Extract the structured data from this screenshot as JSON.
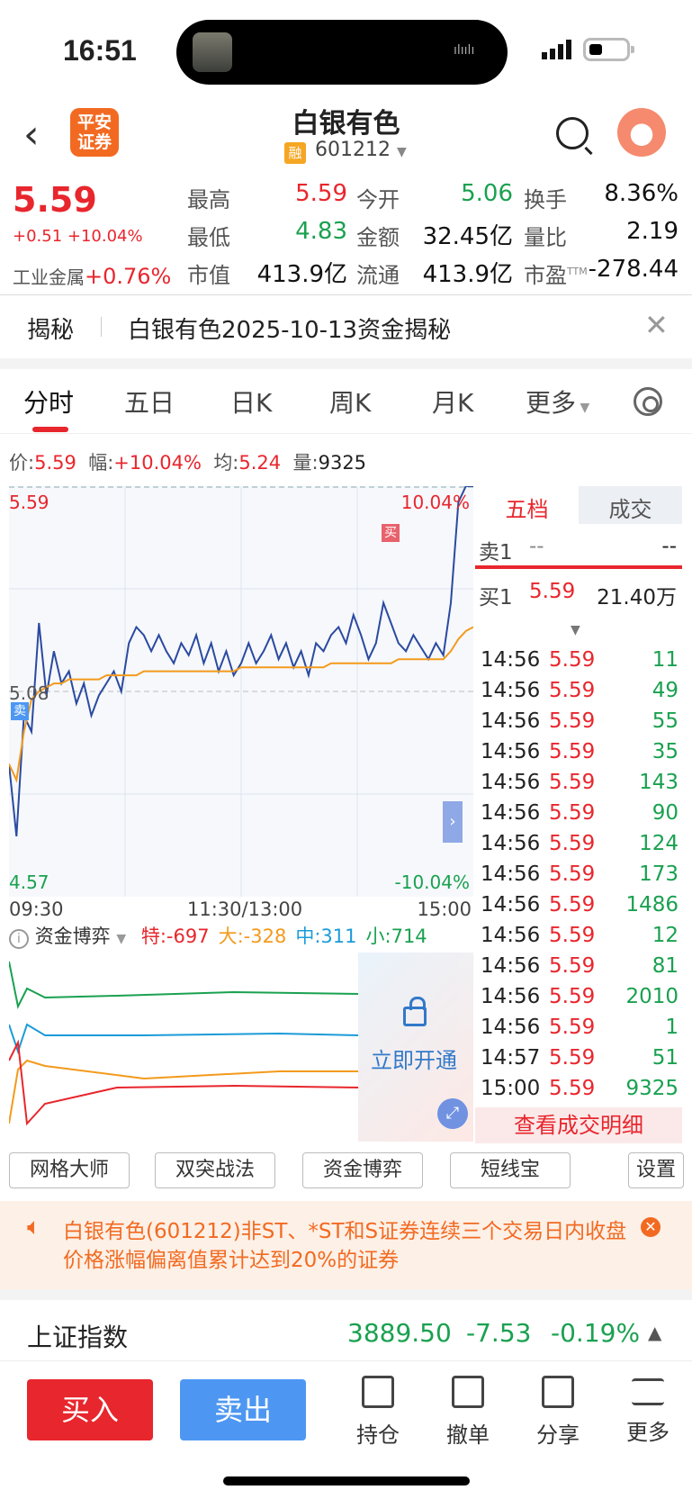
{
  "status_bar": {
    "time": "16:51"
  },
  "header": {
    "logo_text": "平安证券",
    "logo_line1": "平安",
    "logo_line2": "证券",
    "stock_name": "白银有色",
    "margin_tag": "融",
    "stock_code": "601212"
  },
  "quote": {
    "price": "5.59",
    "change": "+0.51 +10.04%",
    "sector_name": "工业金属",
    "sector_change": "+0.76%",
    "fields": [
      {
        "label": "最高",
        "value": "5.59",
        "color": "red"
      },
      {
        "label": "今开",
        "value": "5.06",
        "color": "green"
      },
      {
        "label": "换手",
        "value": "8.36%",
        "color": "black"
      },
      {
        "label": "最低",
        "value": "4.83",
        "color": "green"
      },
      {
        "label": "金额",
        "value": "32.45亿",
        "color": "black"
      },
      {
        "label": "量比",
        "value": "2.19",
        "color": "black"
      },
      {
        "label": "市值",
        "value": "413.9亿",
        "color": "black"
      },
      {
        "label": "流通",
        "value": "413.9亿",
        "color": "black"
      },
      {
        "label": "市盈",
        "value": "-278.44",
        "color": "black",
        "sup": "TTM"
      }
    ]
  },
  "reveal_banner": {
    "tag": "揭秘",
    "text": "白银有色2025-10-13资金揭秘"
  },
  "tabs": [
    "分时",
    "五日",
    "日K",
    "周K",
    "月K",
    "更多"
  ],
  "info_line": {
    "price_label": "价:",
    "price": "5.59",
    "amp_label": "幅:",
    "amp": "+10.04%",
    "avg_label": "均:",
    "avg": "5.24",
    "vol_label": "量:",
    "vol": "9325"
  },
  "chart_data": {
    "type": "line",
    "ylim": [
      4.57,
      5.59
    ],
    "y_ticks": [
      "5.59",
      "5.08",
      "4.57"
    ],
    "pct_ticks": [
      "10.04%",
      "-10.04%"
    ],
    "x_ticks": [
      "09:30",
      "11:30/13:00",
      "15:00"
    ],
    "markers": [
      "卖",
      "买"
    ],
    "series": [
      {
        "name": "price",
        "color": "#2b4aa0",
        "values": [
          4.9,
          4.72,
          5.02,
          4.98,
          5.25,
          5.07,
          5.18,
          5.1,
          5.13,
          5.05,
          5.1,
          5.02,
          5.07,
          5.1,
          5.13,
          5.08,
          5.2,
          5.24,
          5.22,
          5.18,
          5.22,
          5.18,
          5.15,
          5.2,
          5.17,
          5.22,
          5.15,
          5.2,
          5.13,
          5.18,
          5.12,
          5.15,
          5.2,
          5.15,
          5.18,
          5.22,
          5.16,
          5.2,
          5.14,
          5.18,
          5.12,
          5.2,
          5.18,
          5.22,
          5.24,
          5.2,
          5.27,
          5.22,
          5.16,
          5.2,
          5.3,
          5.25,
          5.2,
          5.18,
          5.22,
          5.19,
          5.16,
          5.2,
          5.17,
          5.3,
          5.55,
          5.59,
          5.59
        ]
      },
      {
        "name": "avg",
        "color": "#f39a1c",
        "values": [
          4.9,
          4.86,
          4.98,
          5.06,
          5.08,
          5.09,
          5.1,
          5.1,
          5.11,
          5.11,
          5.11,
          5.11,
          5.11,
          5.12,
          5.12,
          5.12,
          5.12,
          5.12,
          5.13,
          5.13,
          5.13,
          5.13,
          5.13,
          5.13,
          5.13,
          5.13,
          5.13,
          5.13,
          5.13,
          5.13,
          5.13,
          5.14,
          5.14,
          5.14,
          5.14,
          5.14,
          5.14,
          5.14,
          5.14,
          5.14,
          5.14,
          5.14,
          5.14,
          5.15,
          5.15,
          5.15,
          5.15,
          5.15,
          5.15,
          5.15,
          5.15,
          5.15,
          5.16,
          5.16,
          5.16,
          5.16,
          5.16,
          5.16,
          5.16,
          5.18,
          5.21,
          5.23,
          5.24
        ]
      }
    ]
  },
  "capital_game": {
    "title": "资金博弈",
    "items": [
      {
        "label": "特:",
        "value": "-697",
        "color": "#e8262d"
      },
      {
        "label": "大:",
        "value": "-328",
        "color": "#f39a1c"
      },
      {
        "label": "中:",
        "value": "311",
        "color": "#1c9bd8"
      },
      {
        "label": "小:",
        "value": "714",
        "color": "#1aa150"
      }
    ],
    "unlock_text": "立即开通"
  },
  "side_panel": {
    "tabs": [
      "五档",
      "成交"
    ],
    "sell1": {
      "label": "卖1",
      "price": "--",
      "vol": "--"
    },
    "buy1": {
      "label": "买1",
      "price": "5.59",
      "vol": "21.40万"
    },
    "trades": [
      {
        "t": "14:56",
        "p": "5.59",
        "v": "11"
      },
      {
        "t": "14:56",
        "p": "5.59",
        "v": "49"
      },
      {
        "t": "14:56",
        "p": "5.59",
        "v": "55"
      },
      {
        "t": "14:56",
        "p": "5.59",
        "v": "35"
      },
      {
        "t": "14:56",
        "p": "5.59",
        "v": "143"
      },
      {
        "t": "14:56",
        "p": "5.59",
        "v": "90"
      },
      {
        "t": "14:56",
        "p": "5.59",
        "v": "124"
      },
      {
        "t": "14:56",
        "p": "5.59",
        "v": "173"
      },
      {
        "t": "14:56",
        "p": "5.59",
        "v": "1486"
      },
      {
        "t": "14:56",
        "p": "5.59",
        "v": "12"
      },
      {
        "t": "14:56",
        "p": "5.59",
        "v": "81"
      },
      {
        "t": "14:56",
        "p": "5.59",
        "v": "2010"
      },
      {
        "t": "14:56",
        "p": "5.59",
        "v": "1"
      },
      {
        "t": "14:57",
        "p": "5.59",
        "v": "51"
      },
      {
        "t": "15:00",
        "p": "5.59",
        "v": "9325"
      }
    ],
    "detail_button": "查看成交明细"
  },
  "tools": [
    "网格大师",
    "双突战法",
    "资金博弈",
    "短线宝",
    "设置"
  ],
  "notice": {
    "text": "白银有色(601212)非ST、*ST和S证券连续三个交易日内收盘价格涨幅偏离值累计达到20%的证券"
  },
  "index_bar": {
    "name": "上证指数",
    "value": "3889.50",
    "change": "-7.53",
    "pct": "-0.19%"
  },
  "bottom": {
    "buy": "买入",
    "sell": "卖出",
    "actions": [
      "持仓",
      "撤单",
      "分享",
      "更多"
    ]
  }
}
